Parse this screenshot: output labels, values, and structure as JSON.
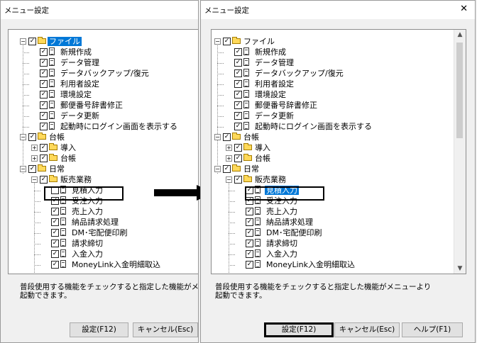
{
  "left_dialog": {
    "title": "メニュー設定",
    "message": "普段使用する機能をチェックすると指定した機能がメニ\n起動できます。",
    "buttons": {
      "settings": "設定(F12)",
      "cancel": "キャンセル(Esc)"
    }
  },
  "right_dialog": {
    "title": "メニュー設定",
    "message": "普段使用する機能をチェックすると指定した機能がメニューより\n起動できます。",
    "buttons": {
      "settings": "設定(F12)",
      "cancel": "キャンセル(Esc)",
      "help": "ヘルプ(F1)"
    }
  },
  "close_glyph": "✕",
  "tree_left": [
    {
      "level": 0,
      "exp": "minus",
      "checked": true,
      "icon": "folder-open",
      "label": "ファイル",
      "selected": true
    },
    {
      "level": 1,
      "checked": true,
      "icon": "document",
      "label": "新規作成"
    },
    {
      "level": 1,
      "checked": true,
      "icon": "document",
      "label": "データ管理"
    },
    {
      "level": 1,
      "checked": true,
      "icon": "document",
      "label": "データバックアップ/復元"
    },
    {
      "level": 1,
      "checked": true,
      "icon": "document",
      "label": "利用者設定"
    },
    {
      "level": 1,
      "checked": true,
      "icon": "document",
      "label": "環境設定"
    },
    {
      "level": 1,
      "checked": true,
      "icon": "document",
      "label": "郵便番号辞書修正"
    },
    {
      "level": 1,
      "checked": true,
      "icon": "document",
      "label": "データ更新"
    },
    {
      "level": 1,
      "checked": true,
      "icon": "document",
      "label": "起動時にログイン画面を表示する"
    },
    {
      "level": 0,
      "exp": "minus",
      "checked": true,
      "icon": "folder-open",
      "label": "台帳"
    },
    {
      "level": 1,
      "exp": "plus",
      "checked": true,
      "icon": "folder",
      "label": "導入"
    },
    {
      "level": 1,
      "exp": "plus",
      "checked": true,
      "icon": "folder",
      "label": "台帳"
    },
    {
      "level": 0,
      "exp": "minus",
      "checked": true,
      "icon": "folder-open",
      "label": "日常"
    },
    {
      "level": 1,
      "exp": "minus",
      "checked": true,
      "icon": "folder-open",
      "label": "販売業務"
    },
    {
      "level": 2,
      "checked": false,
      "icon": "document",
      "label": "見積入力",
      "highlight": true
    },
    {
      "level": 2,
      "checked": true,
      "icon": "document",
      "label": "受注入力"
    },
    {
      "level": 2,
      "checked": true,
      "icon": "document",
      "label": "売上入力"
    },
    {
      "level": 2,
      "checked": true,
      "icon": "document",
      "label": "納品請求処理"
    },
    {
      "level": 2,
      "checked": true,
      "icon": "document",
      "label": "DM･宅配便印刷"
    },
    {
      "level": 2,
      "checked": true,
      "icon": "document",
      "label": "請求締切"
    },
    {
      "level": 2,
      "checked": true,
      "icon": "document",
      "label": "入金入力"
    },
    {
      "level": 2,
      "checked": true,
      "icon": "document",
      "label": "MoneyLink入金明細取込"
    }
  ],
  "tree_right": [
    {
      "level": 0,
      "exp": "minus",
      "checked": true,
      "icon": "folder-open",
      "label": "ファイル"
    },
    {
      "level": 1,
      "checked": true,
      "icon": "document",
      "label": "新規作成"
    },
    {
      "level": 1,
      "checked": true,
      "icon": "document",
      "label": "データ管理"
    },
    {
      "level": 1,
      "checked": true,
      "icon": "document",
      "label": "データバックアップ/復元"
    },
    {
      "level": 1,
      "checked": true,
      "icon": "document",
      "label": "利用者設定"
    },
    {
      "level": 1,
      "checked": true,
      "icon": "document",
      "label": "環境設定"
    },
    {
      "level": 1,
      "checked": true,
      "icon": "document",
      "label": "郵便番号辞書修正"
    },
    {
      "level": 1,
      "checked": true,
      "icon": "document",
      "label": "データ更新"
    },
    {
      "level": 1,
      "checked": true,
      "icon": "document",
      "label": "起動時にログイン画面を表示する"
    },
    {
      "level": 0,
      "exp": "minus",
      "checked": true,
      "icon": "folder-open",
      "label": "台帳"
    },
    {
      "level": 1,
      "exp": "plus",
      "checked": true,
      "icon": "folder",
      "label": "導入"
    },
    {
      "level": 1,
      "exp": "plus",
      "checked": true,
      "icon": "folder",
      "label": "台帳"
    },
    {
      "level": 0,
      "exp": "minus",
      "checked": true,
      "icon": "folder-open",
      "label": "日常"
    },
    {
      "level": 1,
      "exp": "minus",
      "checked": true,
      "icon": "folder-open",
      "label": "販売業務"
    },
    {
      "level": 2,
      "checked": true,
      "icon": "document",
      "label": "見積入力",
      "selected": true,
      "highlight": true
    },
    {
      "level": 2,
      "checked": true,
      "icon": "document",
      "label": "受注入力"
    },
    {
      "level": 2,
      "checked": true,
      "icon": "document",
      "label": "売上入力"
    },
    {
      "level": 2,
      "checked": true,
      "icon": "document",
      "label": "納品請求処理"
    },
    {
      "level": 2,
      "checked": true,
      "icon": "document",
      "label": "DM･宅配便印刷"
    },
    {
      "level": 2,
      "checked": true,
      "icon": "document",
      "label": "請求締切"
    },
    {
      "level": 2,
      "checked": true,
      "icon": "document",
      "label": "入金入力"
    },
    {
      "level": 2,
      "checked": true,
      "icon": "document",
      "label": "MoneyLink入金明細取込"
    }
  ],
  "scrollbar": {
    "up_glyph": "▲",
    "down_glyph": "▼"
  },
  "check_glyph": "✓",
  "colors": {
    "selection": "#0078d7",
    "folder": "#ffd95a",
    "highlight_border": "#000000"
  }
}
